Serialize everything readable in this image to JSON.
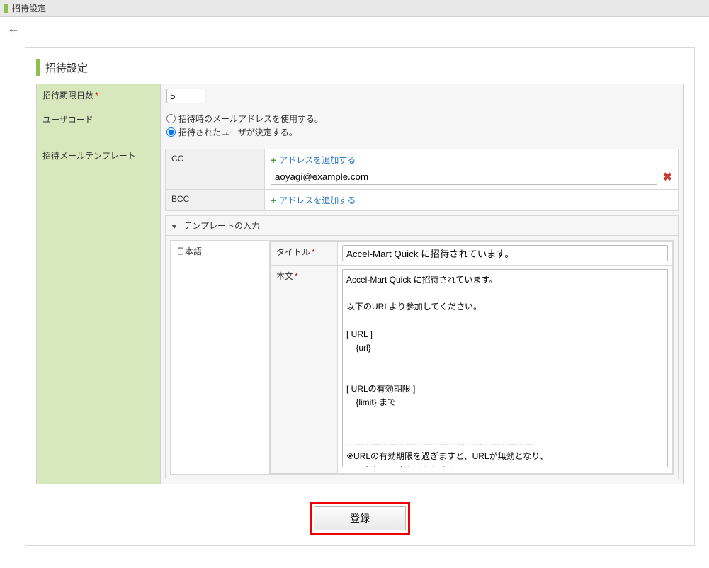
{
  "header": {
    "title": "招待設定"
  },
  "section": {
    "title": "招待設定"
  },
  "fields": {
    "expiry_days": {
      "label": "招待期限日数",
      "value": "5"
    },
    "user_code": {
      "label": "ユーザコード",
      "option1": "招待時のメールアドレスを使用する。",
      "option2": "招待されたユーザが決定する。"
    },
    "mail_template": {
      "label": "招待メールテンプレート",
      "cc_label": "CC",
      "bcc_label": "BCC",
      "add_address": "アドレスを追加する",
      "cc_value": "aoyagi@example.com",
      "accordion": "テンプレートの入力",
      "lang": "日本語",
      "title_label": "タイトル",
      "title_value": "Accel-Mart Quick に招待されています。",
      "body_label": "本文",
      "body_value": "Accel-Mart Quick に招待されています。\n\n以下のURLより参加してください。\n\n[ URL ]\n    {url}\n\n\n[ URLの有効期限 ]\n    {limit} まで\n\n\n…………………………………………………………\n※URLの有効期限を過ぎますと、URLが無効となり、\n　アクセスできなくなります。\n\n※当メールはシステムから自動で配信されております。\n　このメールアドレスに返信していただきましても"
    }
  },
  "buttons": {
    "register": "登録"
  }
}
